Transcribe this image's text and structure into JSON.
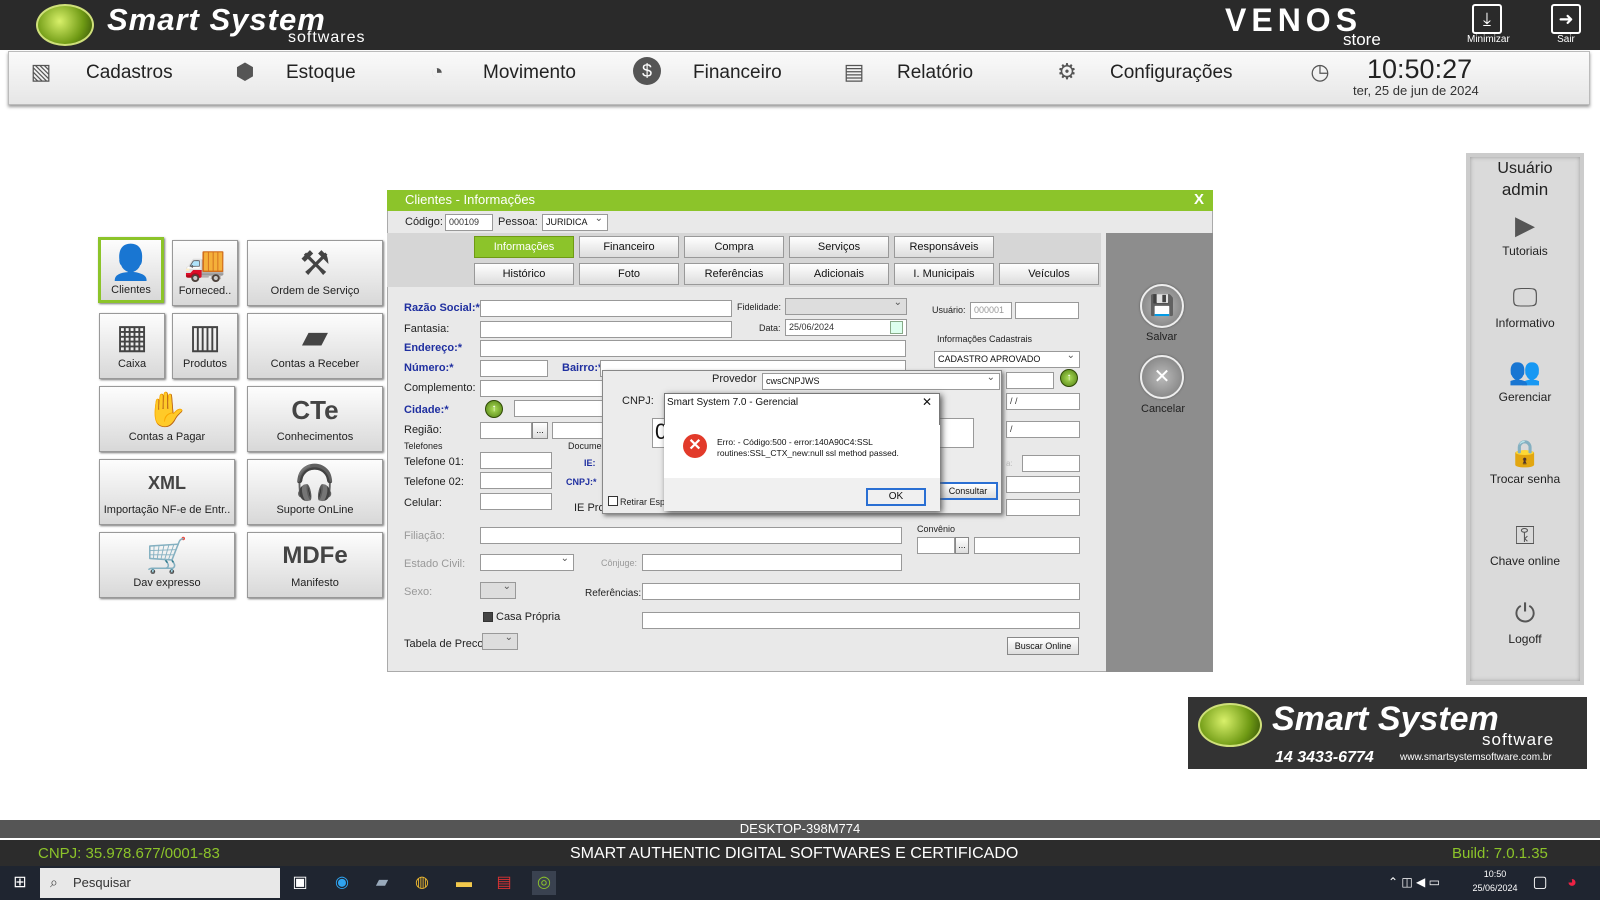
{
  "header": {
    "brand": "Smart System",
    "brand_sub": "softwares",
    "partner": "VENOS",
    "partner_sub": "store",
    "minimize": "Minimizar",
    "exit": "Sair"
  },
  "menu": {
    "items": [
      "Cadastros",
      "Estoque",
      "Movimento",
      "Financeiro",
      "Relatório",
      "Configurações"
    ],
    "time": "10:50:27",
    "date": "ter, 25 de  jun  de  2024"
  },
  "tiles": [
    "Clientes",
    "Forneced..",
    "Ordem de Serviço",
    "Caixa",
    "Produtos",
    "Contas a Receber",
    "Contas a Pagar",
    "Conhecimentos",
    "Importação NF-e de Entr..",
    "Suporte OnLine",
    "Dav expresso",
    "Manifesto"
  ],
  "window": {
    "title": "Clientes - Informações",
    "close": "X",
    "codigo_label": "Código:",
    "codigo": "000109",
    "pessoa_label": "Pessoa:",
    "pessoa": "JURIDICA",
    "tabs_row1": [
      "Informações",
      "Financeiro",
      "Compra",
      "Serviços",
      "Responsáveis"
    ],
    "tabs_row2": [
      "Histórico",
      "Foto",
      "Referências",
      "Adicionais",
      "I. Municipais",
      "Veículos"
    ],
    "labels": {
      "razao": "Razão Social:*",
      "fantasia": "Fantasia:",
      "endereco": "Endereço:*",
      "numero": "Número:*",
      "bairro": "Bairro:*",
      "complemento": "Complemento:",
      "cidade": "Cidade:*",
      "regiao": "Região:",
      "telefones": "Telefones",
      "tel1": "Telefone 01:",
      "tel2": "Telefone 02:",
      "celular": "Celular:",
      "docume": "Docume",
      "ie": "IE:",
      "cnpj": "CNPJ:*",
      "iepro": "IE Pro",
      "filiacao": "Filiação:",
      "estado_civil": "Estado Civil:",
      "conjuge": "Cônjuge:",
      "sexo": "Sexo:",
      "referencias": "Referências:",
      "casa_propria": "Casa Própria",
      "tabela": "Tabela de Preco",
      "fidelidade": "Fidelidade:",
      "data": "Data:",
      "usuario": "Usuário:",
      "info_cad": "Informações Cadastrais",
      "convenio": "Convênio",
      "buscar": "Buscar Online",
      "ellipsis": "...",
      "ela_trunc": "a:"
    },
    "data_value": "25/06/2024",
    "usuario_value": "000001",
    "status": "CADASTRO APROVADO",
    "date_mask": "/ /",
    "date_mask2": "/",
    "salvar": "Salvar",
    "cancelar": "Cancelar"
  },
  "provider": {
    "label": "Provedor",
    "value": "cwsCNPJWS",
    "cnpj": "CNPJ:",
    "cnpj_digit": "0",
    "retirar": "Retirar Esp",
    "consultar": "Consultar"
  },
  "error": {
    "title": "Smart System 7.0 - Gerencial",
    "close": "✕",
    "line1": "Erro:  - Código:500 -  error:140A90C4:SSL",
    "line2": "routines:SSL_CTX_new:null ssl method passed.",
    "ok": "OK"
  },
  "rpanel": {
    "user_label": "Usuário",
    "user": "admin",
    "items": [
      "Tutoriais",
      "Informativo",
      "Gerenciar",
      "Trocar senha",
      "Chave online",
      "Logoff"
    ]
  },
  "ad": {
    "brand": "Smart System",
    "sub": "software",
    "phone": "14 3433-6774",
    "url": "www.smartsystemsoftware.com.br"
  },
  "bottom": {
    "host": "DESKTOP-398M774",
    "cnpj": "CNPJ: 35.978.677/0001-83",
    "company": "SMART AUTHENTIC DIGITAL SOFTWARES E CERTIFICADO",
    "build": "Build: 7.0.1.35"
  },
  "taskbar": {
    "search": "Pesquisar",
    "time": "10:50",
    "date": "25/06/2024"
  },
  "colors": {
    "accent": "#8cc42a",
    "header": "#2a2a2a",
    "error": "#e23a2a"
  }
}
